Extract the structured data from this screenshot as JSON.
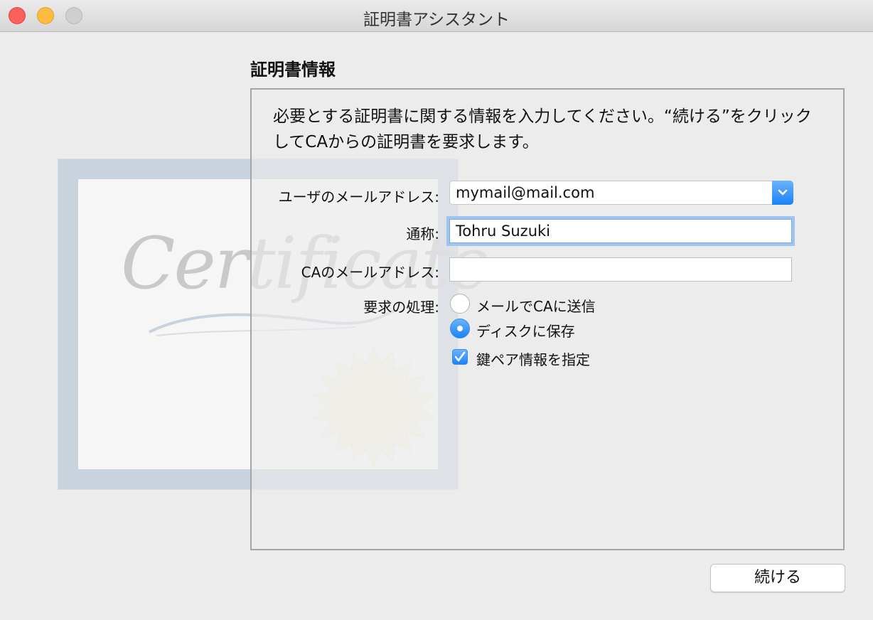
{
  "window": {
    "title": "証明書アシスタント"
  },
  "section": {
    "title": "証明書情報"
  },
  "intro": {
    "text": "必要とする証明書に関する情報を入力してください。“続ける”をクリックしてCAからの証明書を要求します。"
  },
  "illustration": {
    "word": "Certificate"
  },
  "form": {
    "user_email": {
      "label": "ユーザのメールアドレス:",
      "value": "mymail@mail.com"
    },
    "common_name": {
      "label": "通称:",
      "value": "Tohru Suzuki"
    },
    "ca_email": {
      "label": "CAのメールアドレス:",
      "value": ""
    },
    "request": {
      "label": "要求の処理:",
      "options": [
        {
          "label": "メールでCAに送信",
          "selected": false
        },
        {
          "label": "ディスクに保存",
          "selected": true
        }
      ]
    },
    "key_pair": {
      "label": "鍵ペア情報を指定",
      "checked": true
    }
  },
  "buttons": {
    "continue": "続ける"
  },
  "colors": {
    "accent": "#1a82f7",
    "close": "#fc605c",
    "minimize": "#fdbc40",
    "zoom_disabled": "#cfcfcf"
  }
}
